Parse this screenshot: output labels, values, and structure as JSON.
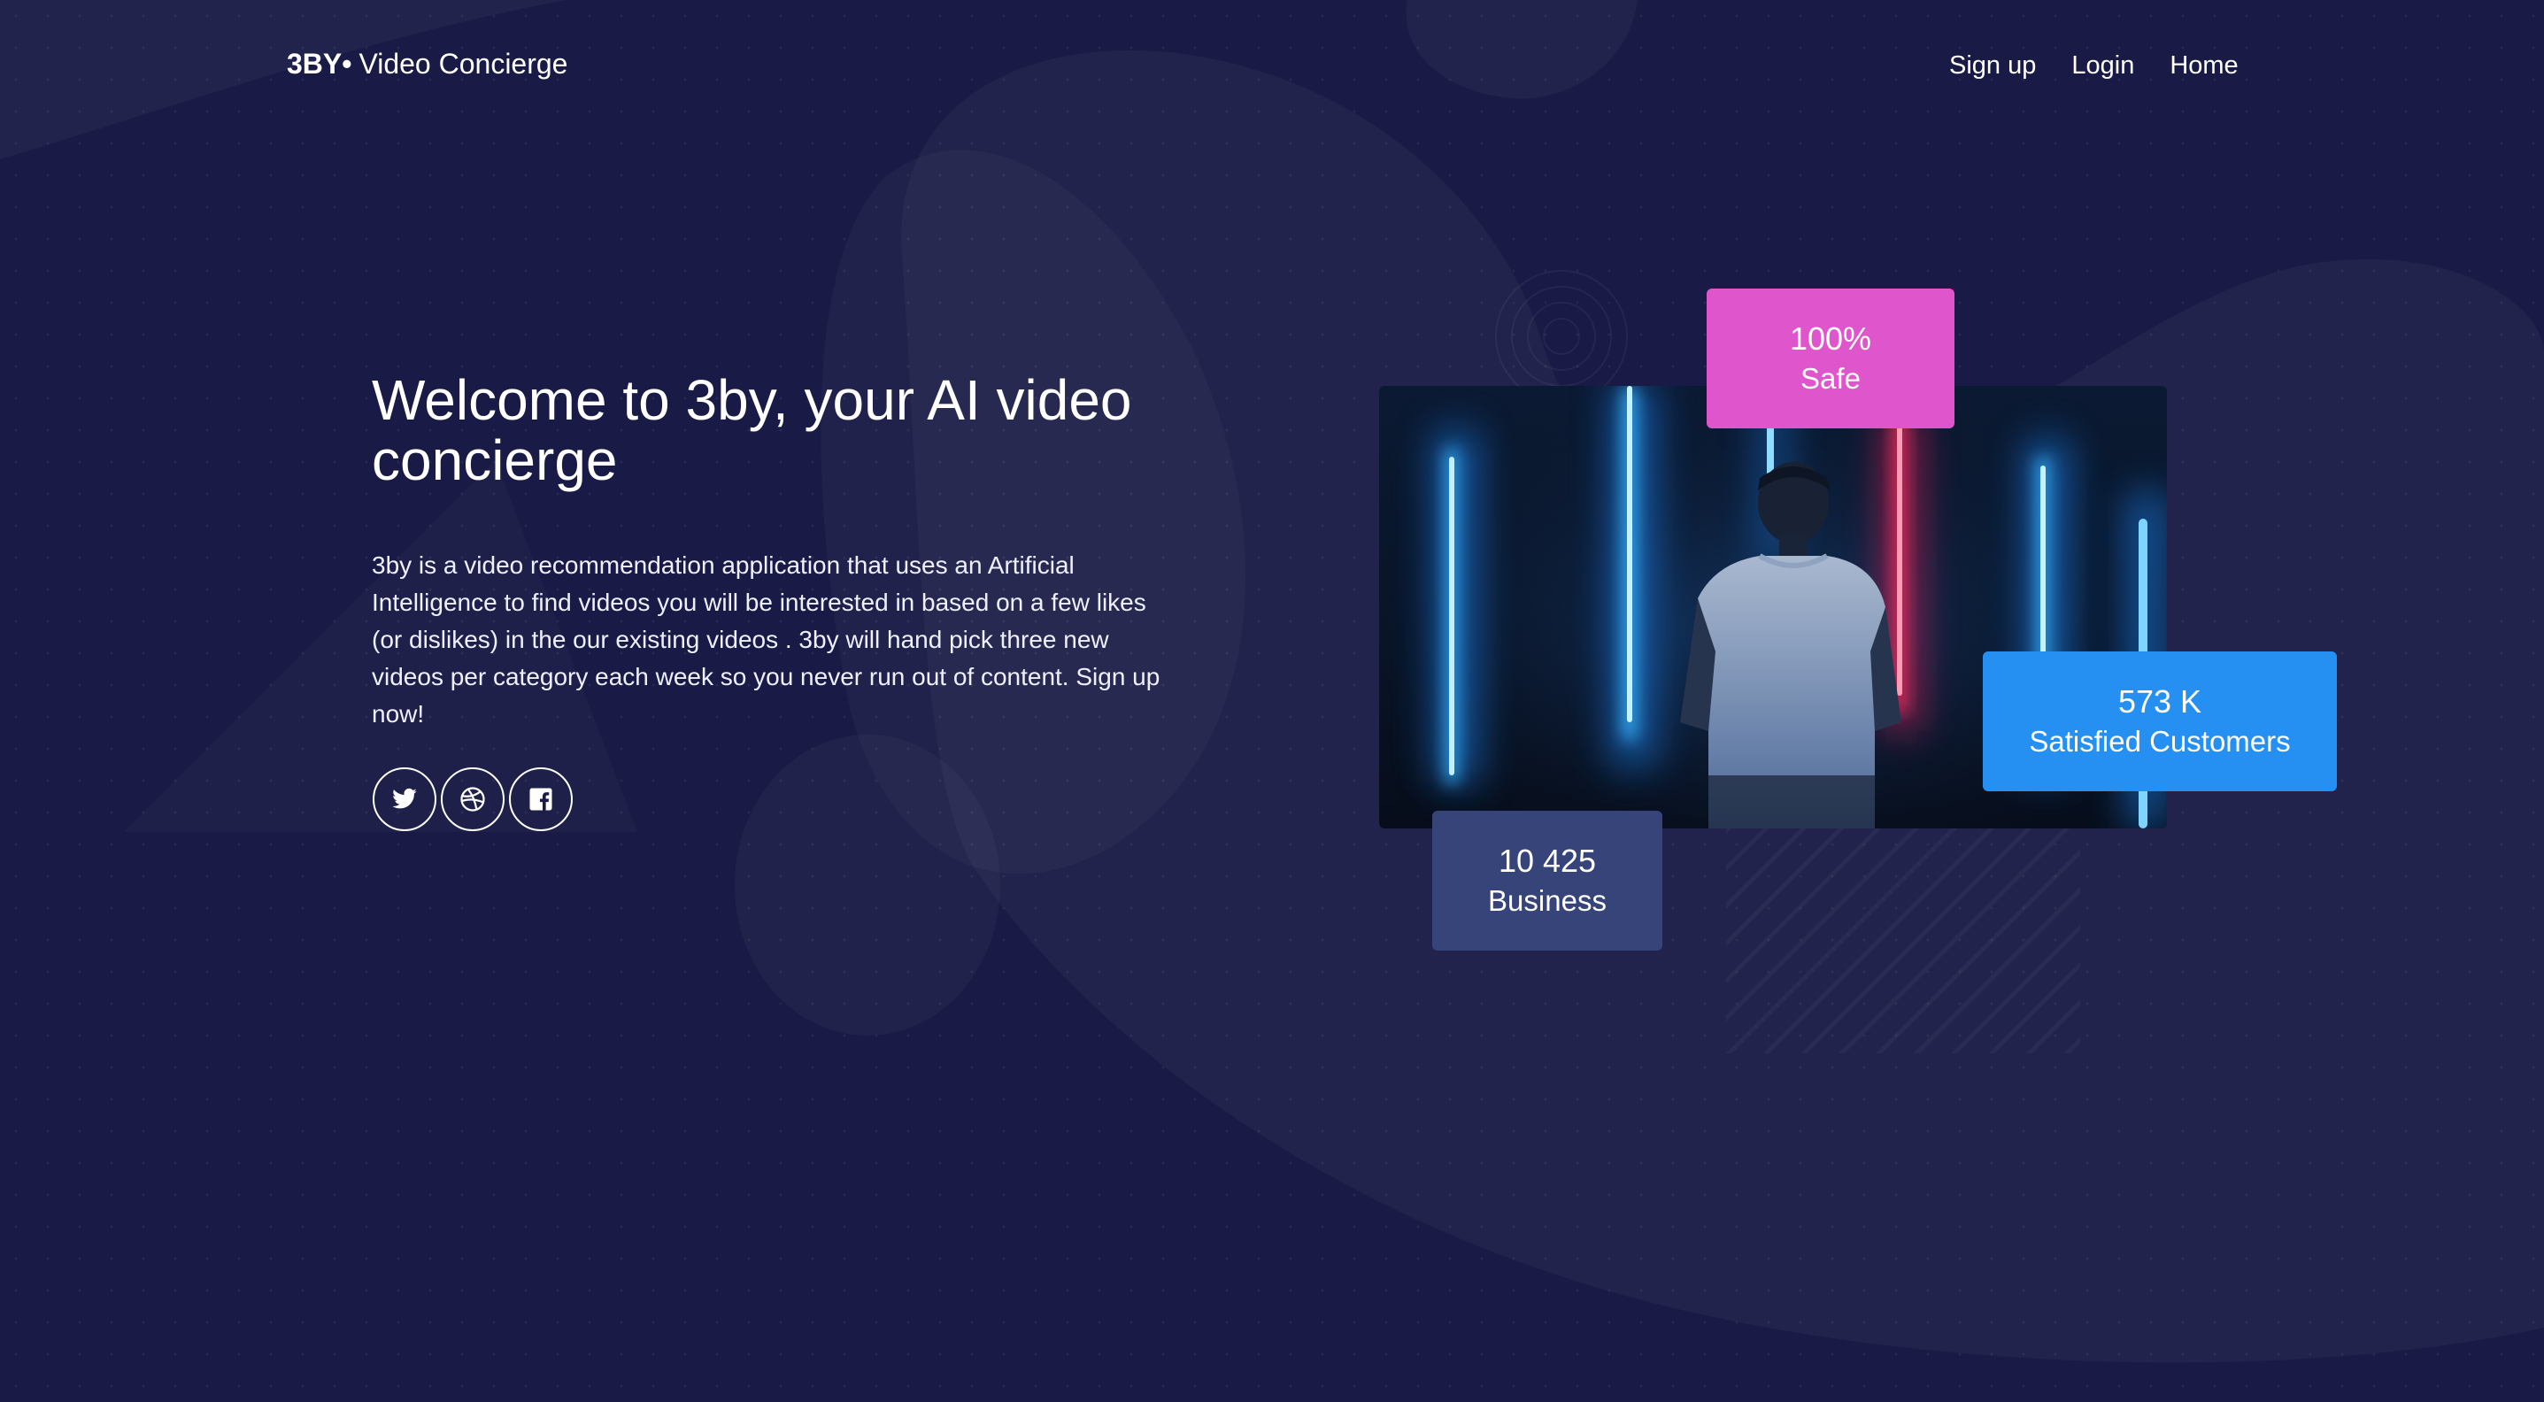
{
  "header": {
    "brand_mark": "3BY",
    "brand_dot": "•",
    "brand_name": "Video Concierge",
    "nav": [
      {
        "label": "Sign up"
      },
      {
        "label": "Login"
      },
      {
        "label": "Home"
      }
    ]
  },
  "hero": {
    "title": "Welcome to 3by, your AI video concierge",
    "description": "3by is a video recommendation application that uses an Artificial Intelligence to find videos you will be interested in based on a few likes (or dislikes) in  the our existing videos . 3by will hand pick three new videos per category each week so you never run out of content. Sign up now!",
    "socials": [
      {
        "icon": "twitter-icon"
      },
      {
        "icon": "dribbble-icon"
      },
      {
        "icon": "facebook-icon"
      }
    ]
  },
  "stats": {
    "safe": {
      "value": "100%",
      "label": "Safe",
      "color": "#df55cc"
    },
    "customers": {
      "value": "573 K",
      "label": "Satisfied Customers",
      "color": "#2590f2"
    },
    "business": {
      "value": "10 425",
      "label": "Business",
      "color": "#36447a"
    }
  },
  "colors": {
    "background": "#191b46",
    "text": "#ffffff"
  }
}
